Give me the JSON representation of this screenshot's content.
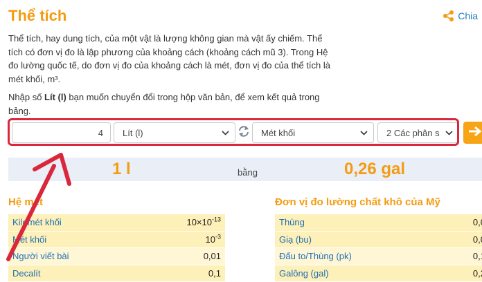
{
  "page": {
    "title": "Thể tích",
    "share_label": "Chia"
  },
  "intro": "Thể tích, hay dung tích, của một vật là lượng không gian mà vật ấy chiếm. Thể tích có đơn vị đo là lập phương của khoảng cách (khoảng cách mũ 3). Trong Hệ đo lường quốc tế, do đơn vị đo của khoảng cách là mét, đơn vị đo của thể tích là mét khối, m³.",
  "instruction": {
    "before": "Nhập số ",
    "bold": "Lít (l)",
    "after": " bạn muốn chuyển đổi trong hộp văn bản, để xem kết quả trong bảng."
  },
  "converter": {
    "input_value": "4",
    "from_unit": "Lít (l)",
    "to_unit": "Mét khối",
    "precision": "2 Các phân s"
  },
  "result": {
    "left": "1 l",
    "middle": "bằng",
    "right": "0,26 gal"
  },
  "metric": {
    "title": "Hệ mét",
    "rows": [
      {
        "name": "Kilomét khối",
        "mantissa": "10×10",
        "exp": "-13"
      },
      {
        "name": "Mét khối",
        "mantissa": "10",
        "exp": "-3"
      },
      {
        "name": "Người viết bài",
        "mantissa": "0,01",
        "exp": ""
      },
      {
        "name": "Decalít",
        "mantissa": "0,1",
        "exp": ""
      }
    ]
  },
  "us_dry": {
    "title": "Đơn vị đo lường chất khô của Mỹ",
    "rows": [
      {
        "name": "Thùng",
        "value": "0,0"
      },
      {
        "name": "Giạ (bu)",
        "value": "0,0"
      },
      {
        "name": "Đấu to/Thùng (pk)",
        "value": "0,1"
      },
      {
        "name": "Galông (gal)",
        "value": "0,2"
      }
    ]
  },
  "colors": {
    "accent": "#f39c12",
    "link": "#1f6fb5",
    "highlight_border": "#d9283c",
    "annotation_arrow": "#d9283c"
  }
}
